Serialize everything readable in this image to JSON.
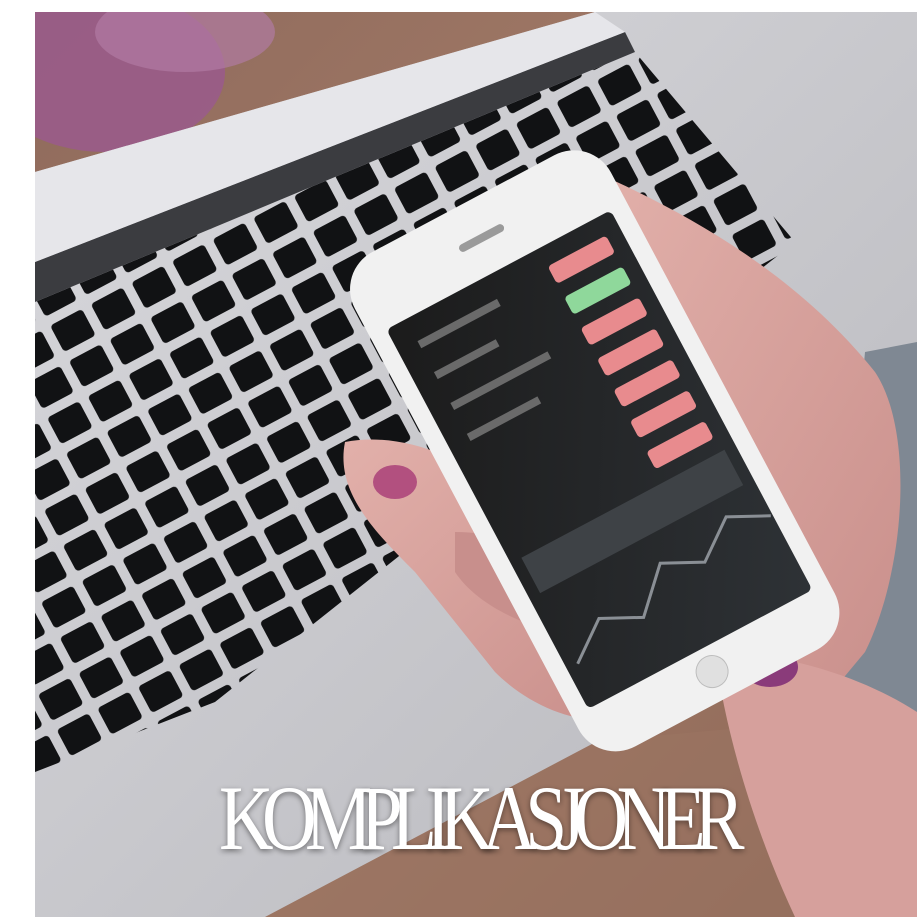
{
  "caption": {
    "text": "KOMPLIKASJONER"
  },
  "colors": {
    "wood": "#9a7361",
    "laptop_silver": "#c9c9cd",
    "key_black": "#111214",
    "phone_white": "#f1f1f1",
    "screen_dark": "#151515",
    "candle_red": "#e88b8e",
    "candle_green": "#8fd89b",
    "skin": "#d8a3a0",
    "nail_polish": "#8a3b7a",
    "sweater_gray": "#7f8893"
  },
  "icons": [
    "smartphone-image",
    "laptop-keyboard-image",
    "hands-image"
  ]
}
